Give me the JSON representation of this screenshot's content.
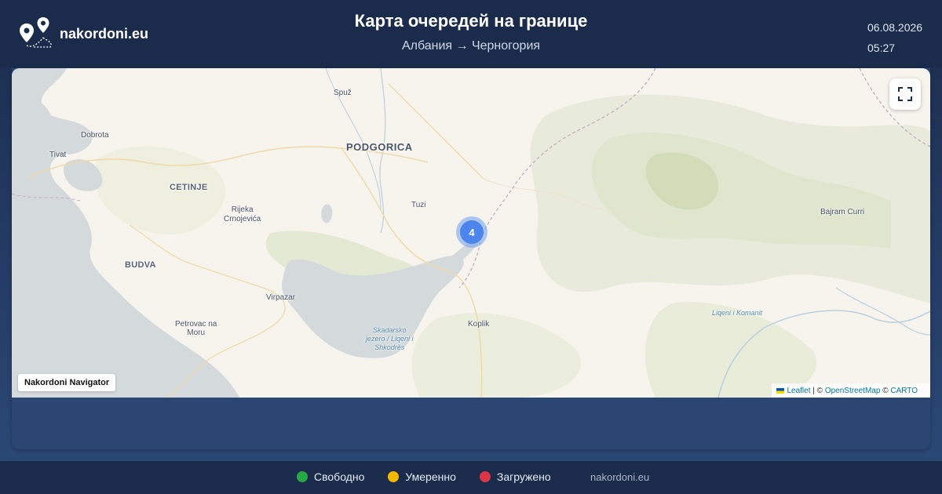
{
  "header": {
    "site_name": "nakordoni.eu",
    "title": "Карта очередей на границе",
    "route": "Албания → Черногория",
    "date": "06.08.2026",
    "time": "05:27"
  },
  "map": {
    "places": {
      "spuz": "Spuž",
      "dobrota": "Dobrota",
      "tivat": "Tivat",
      "podgorica": "PODGORICA",
      "cetinje": "CETINJE",
      "tuzi": "Tuzi",
      "rijeka": "Rijeka\nCrnojevića",
      "budva": "BUDVA",
      "virpazar": "Virpazar",
      "petrovac": "Petrovac na\nMoru",
      "koplik": "Koplik",
      "bajram": "Bajram Curri",
      "skadar": "Skadarsko\njezero / Liqeni i\nShkodrës",
      "komanit": "Liqeni i Komanit"
    },
    "cluster_count": "4",
    "fullscreen_icon": "fullscreen-icon",
    "navigator_label": "Nakordoni Navigator",
    "attribution": {
      "leaflet": "Leaflet",
      "sep1": " | © ",
      "osm": "OpenStreetMap",
      "sep2": " © ",
      "carto": "CARTO"
    }
  },
  "legend": [
    {
      "label": "Свободно",
      "color": "#28a745"
    },
    {
      "label": "Умеренно",
      "color": "#f5b800"
    },
    {
      "label": "Загружено",
      "color": "#dc3545"
    }
  ],
  "footer": {
    "site": "nakordoni.eu"
  },
  "colors": {
    "header_bg": "#1b2b4b",
    "cluster": "#4d85ec"
  }
}
